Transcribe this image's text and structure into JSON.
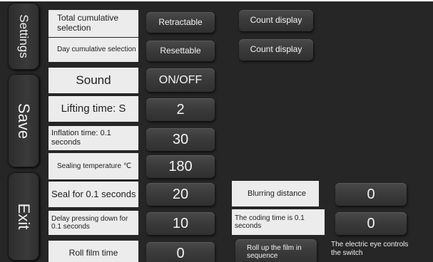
{
  "sidebar": {
    "settings": "Settings",
    "save": "Save",
    "exit": "Exit"
  },
  "rows": {
    "total_cumulative": {
      "label": "Total cumulative selection",
      "button": "Retractable",
      "display": "Count display"
    },
    "day_cumulative": {
      "label": "Day cumulative selection",
      "button": "Resettable",
      "display": "Count display"
    },
    "sound": {
      "label": "Sound",
      "value": "ON/OFF"
    },
    "lifting_time": {
      "label": "Lifting time: S",
      "value": "2"
    },
    "inflation_time": {
      "label": "Inflation time: 0.1 seconds",
      "value": "30"
    },
    "sealing_temperature": {
      "label": "Sealing temperature ℃",
      "value": "180"
    },
    "seal_time": {
      "label": "Seal for 0.1 seconds",
      "value": "20"
    },
    "delay_pressing": {
      "label": "Delay pressing down for 0.1 seconds",
      "value": "10"
    },
    "roll_film_time": {
      "label": "Roll film time",
      "value": "0"
    }
  },
  "right": {
    "blurring": {
      "label": "Blurring distance",
      "value": "0"
    },
    "coding_time": {
      "label": "The coding time is 0.1 seconds",
      "value": "0"
    },
    "roll_up": {
      "label": "Roll up the film in sequence"
    },
    "electric_eye": {
      "label": "The electric eye controls the switch"
    }
  }
}
